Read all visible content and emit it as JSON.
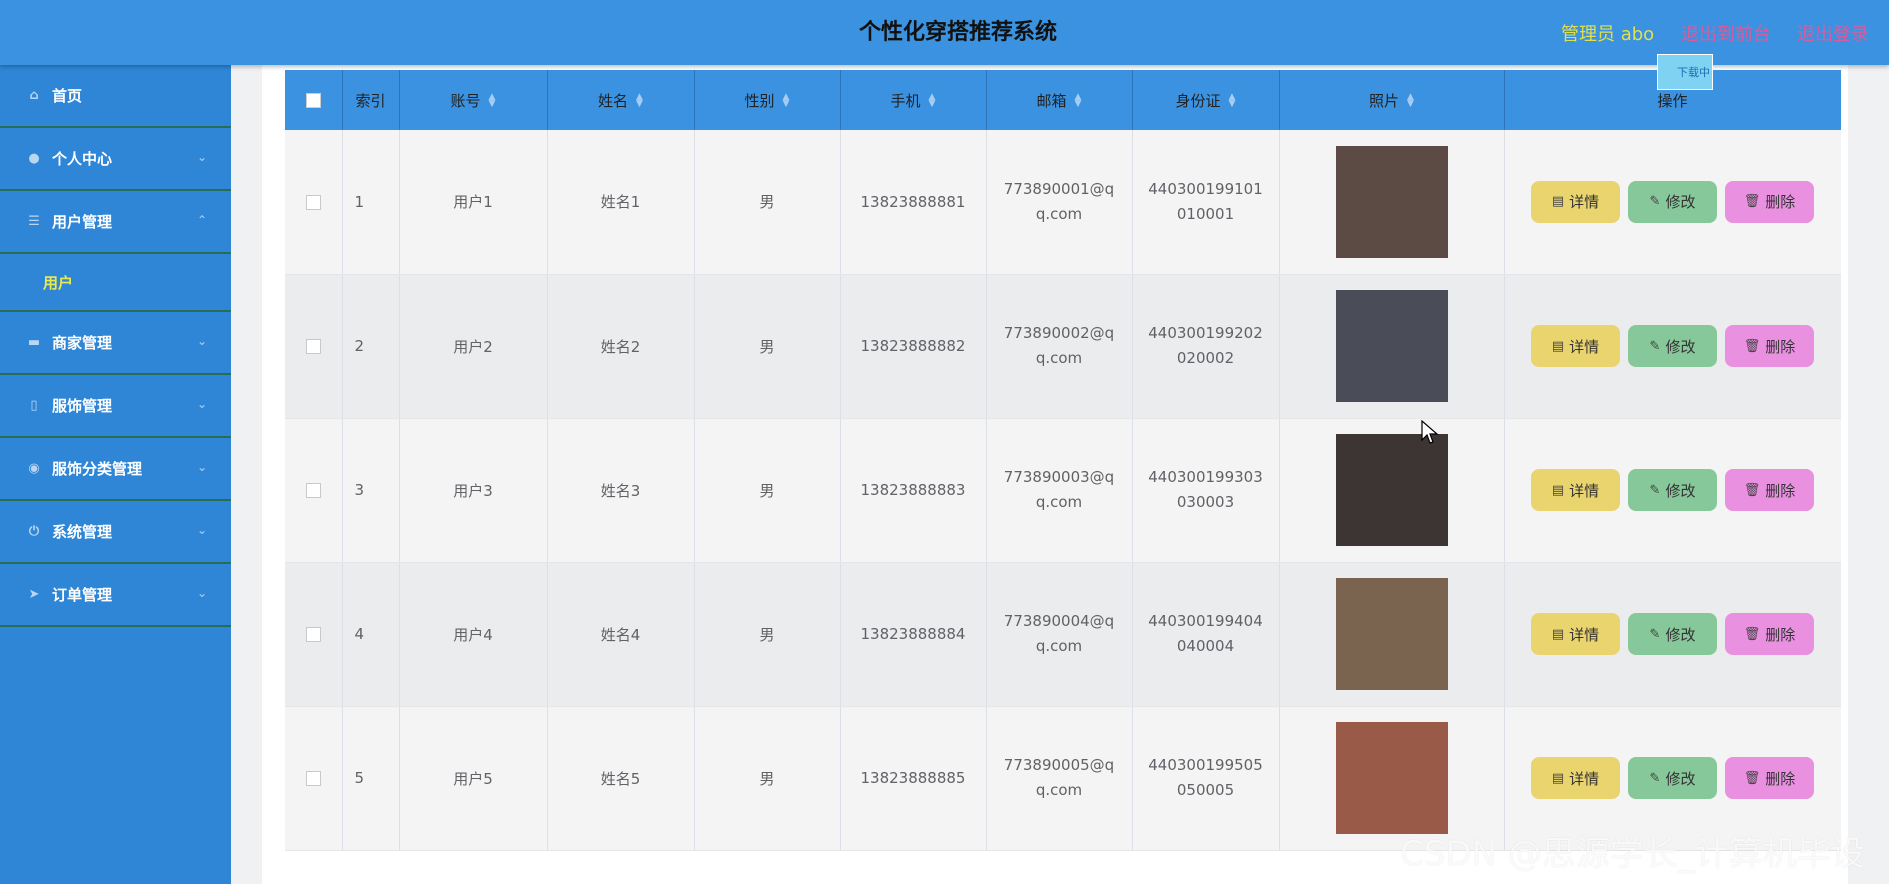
{
  "header": {
    "title": "个性化穿搭推荐系统",
    "admin": "管理员 abo",
    "back": "退出到前台",
    "logout": "退出登录",
    "download_tip": "下载中"
  },
  "sidebar": {
    "items": [
      {
        "label": "首页",
        "icon": "home-icon"
      },
      {
        "label": "个人中心",
        "icon": "user-icon"
      },
      {
        "label": "用户管理",
        "icon": "list-icon"
      },
      {
        "label": "商家管理",
        "icon": "shop-icon"
      },
      {
        "label": "服饰管理",
        "icon": "phone-icon"
      },
      {
        "label": "服饰分类管理",
        "icon": "location-icon"
      },
      {
        "label": "系统管理",
        "icon": "power-icon"
      },
      {
        "label": "订单管理",
        "icon": "send-icon"
      }
    ],
    "active_sub": "用户"
  },
  "table": {
    "columns": [
      "索引",
      "账号",
      "姓名",
      "性别",
      "手机",
      "邮箱",
      "身份证",
      "照片",
      "操作"
    ],
    "rows": [
      {
        "idx": "1",
        "account": "用户1",
        "name": "姓名1",
        "gender": "男",
        "phone": "13823888881",
        "email": "773890001@qq.com",
        "id": "440300199101010001",
        "photo_color": "#5c4a44"
      },
      {
        "idx": "2",
        "account": "用户2",
        "name": "姓名2",
        "gender": "男",
        "phone": "13823888882",
        "email": "773890002@qq.com",
        "id": "440300199202020002",
        "photo_color": "#4a4c57"
      },
      {
        "idx": "3",
        "account": "用户3",
        "name": "姓名3",
        "gender": "男",
        "phone": "13823888883",
        "email": "773890003@qq.com",
        "id": "440300199303030003",
        "photo_color": "#3d3533"
      },
      {
        "idx": "4",
        "account": "用户4",
        "name": "姓名4",
        "gender": "男",
        "phone": "13823888884",
        "email": "773890004@qq.com",
        "id": "440300199404040004",
        "photo_color": "#7a6450"
      },
      {
        "idx": "5",
        "account": "用户5",
        "name": "姓名5",
        "gender": "男",
        "phone": "13823888885",
        "email": "773890005@qq.com",
        "id": "440300199505050005",
        "photo_color": "#9a5a48"
      }
    ],
    "actions": {
      "detail": "详情",
      "edit": "修改",
      "delete": "删除"
    }
  },
  "watermark": "CSDN @思源学长_计算机毕设",
  "colors": {
    "header": "#3a92e0",
    "sidebar": "#2f86d6",
    "detail": "#e9d46e",
    "edit": "#86c89a",
    "delete": "#ea90e1"
  }
}
